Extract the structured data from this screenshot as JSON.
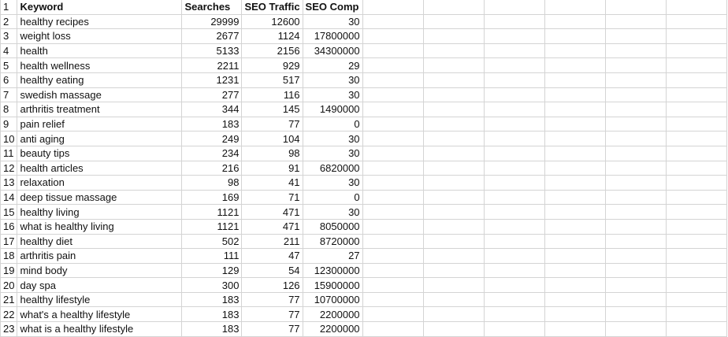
{
  "headers": {
    "row": "1",
    "keyword": "Keyword",
    "searches": "Searches",
    "traffic": "SEO Traffic",
    "comp": "SEO Comp"
  },
  "rows": [
    {
      "n": "2",
      "keyword": "healthy recipes",
      "searches": "29999",
      "traffic": "12600",
      "comp": "30"
    },
    {
      "n": "3",
      "keyword": "weight loss",
      "searches": "2677",
      "traffic": "1124",
      "comp": "17800000"
    },
    {
      "n": "4",
      "keyword": "health",
      "searches": "5133",
      "traffic": "2156",
      "comp": "34300000"
    },
    {
      "n": "5",
      "keyword": "health wellness",
      "searches": "2211",
      "traffic": "929",
      "comp": "29"
    },
    {
      "n": "6",
      "keyword": "healthy eating",
      "searches": "1231",
      "traffic": "517",
      "comp": "30"
    },
    {
      "n": "7",
      "keyword": "swedish massage",
      "searches": "277",
      "traffic": "116",
      "comp": "30"
    },
    {
      "n": "8",
      "keyword": "arthritis treatment",
      "searches": "344",
      "traffic": "145",
      "comp": "1490000"
    },
    {
      "n": "9",
      "keyword": "pain relief",
      "searches": "183",
      "traffic": "77",
      "comp": "0"
    },
    {
      "n": "10",
      "keyword": "anti aging",
      "searches": "249",
      "traffic": "104",
      "comp": "30"
    },
    {
      "n": "11",
      "keyword": "beauty tips",
      "searches": "234",
      "traffic": "98",
      "comp": "30"
    },
    {
      "n": "12",
      "keyword": "health articles",
      "searches": "216",
      "traffic": "91",
      "comp": "6820000"
    },
    {
      "n": "13",
      "keyword": "relaxation",
      "searches": "98",
      "traffic": "41",
      "comp": "30"
    },
    {
      "n": "14",
      "keyword": "deep tissue massage",
      "searches": "169",
      "traffic": "71",
      "comp": "0"
    },
    {
      "n": "15",
      "keyword": "healthy living",
      "searches": "1121",
      "traffic": "471",
      "comp": "30"
    },
    {
      "n": "16",
      "keyword": "what is healthy living",
      "searches": "1121",
      "traffic": "471",
      "comp": "8050000"
    },
    {
      "n": "17",
      "keyword": "healthy diet",
      "searches": "502",
      "traffic": "211",
      "comp": "8720000"
    },
    {
      "n": "18",
      "keyword": "arthritis pain",
      "searches": "111",
      "traffic": "47",
      "comp": "27"
    },
    {
      "n": "19",
      "keyword": "mind body",
      "searches": "129",
      "traffic": "54",
      "comp": "12300000"
    },
    {
      "n": "20",
      "keyword": "day spa",
      "searches": "300",
      "traffic": "126",
      "comp": "15900000"
    },
    {
      "n": "21",
      "keyword": "healthy lifestyle",
      "searches": "183",
      "traffic": "77",
      "comp": "10700000"
    },
    {
      "n": "22",
      "keyword": "what's a healthy lifestyle",
      "searches": "183",
      "traffic": "77",
      "comp": "2200000"
    },
    {
      "n": "23",
      "keyword": "what is a healthy lifestyle",
      "searches": "183",
      "traffic": "77",
      "comp": "2200000"
    }
  ]
}
